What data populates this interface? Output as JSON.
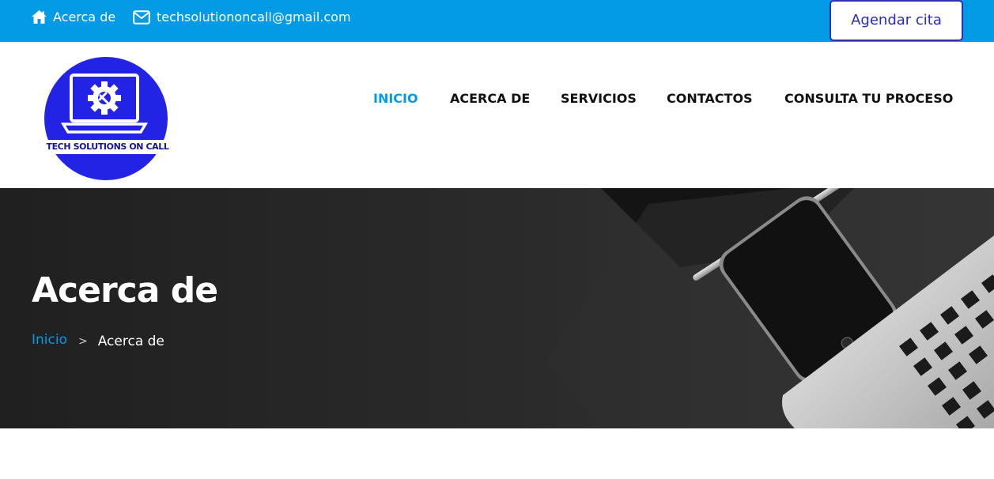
{
  "topbar": {
    "home_label": "Acerca de",
    "email": "techsolutiononcall@gmail.com",
    "cta_label": "Agendar cita",
    "color": "#039be5"
  },
  "logo": {
    "text": "TECH SOLUTIONS ON CALL",
    "circle_color": "#2323e6"
  },
  "nav": {
    "items": [
      {
        "label": "INICIO",
        "active": true
      },
      {
        "label": "ACERCA DE",
        "active": false
      },
      {
        "label": "SERVICIOS",
        "active": false
      },
      {
        "label": "CONTACTOS",
        "active": false
      },
      {
        "label": "CONSULTA TU PROCESO",
        "active": false
      }
    ],
    "active_color": "#039be5"
  },
  "hero": {
    "title": "Acerca de",
    "breadcrumb": {
      "home": "Inicio",
      "separator": ">",
      "current": "Acerca de"
    }
  },
  "icons": {
    "home": "home-icon",
    "mail": "envelope-icon"
  }
}
